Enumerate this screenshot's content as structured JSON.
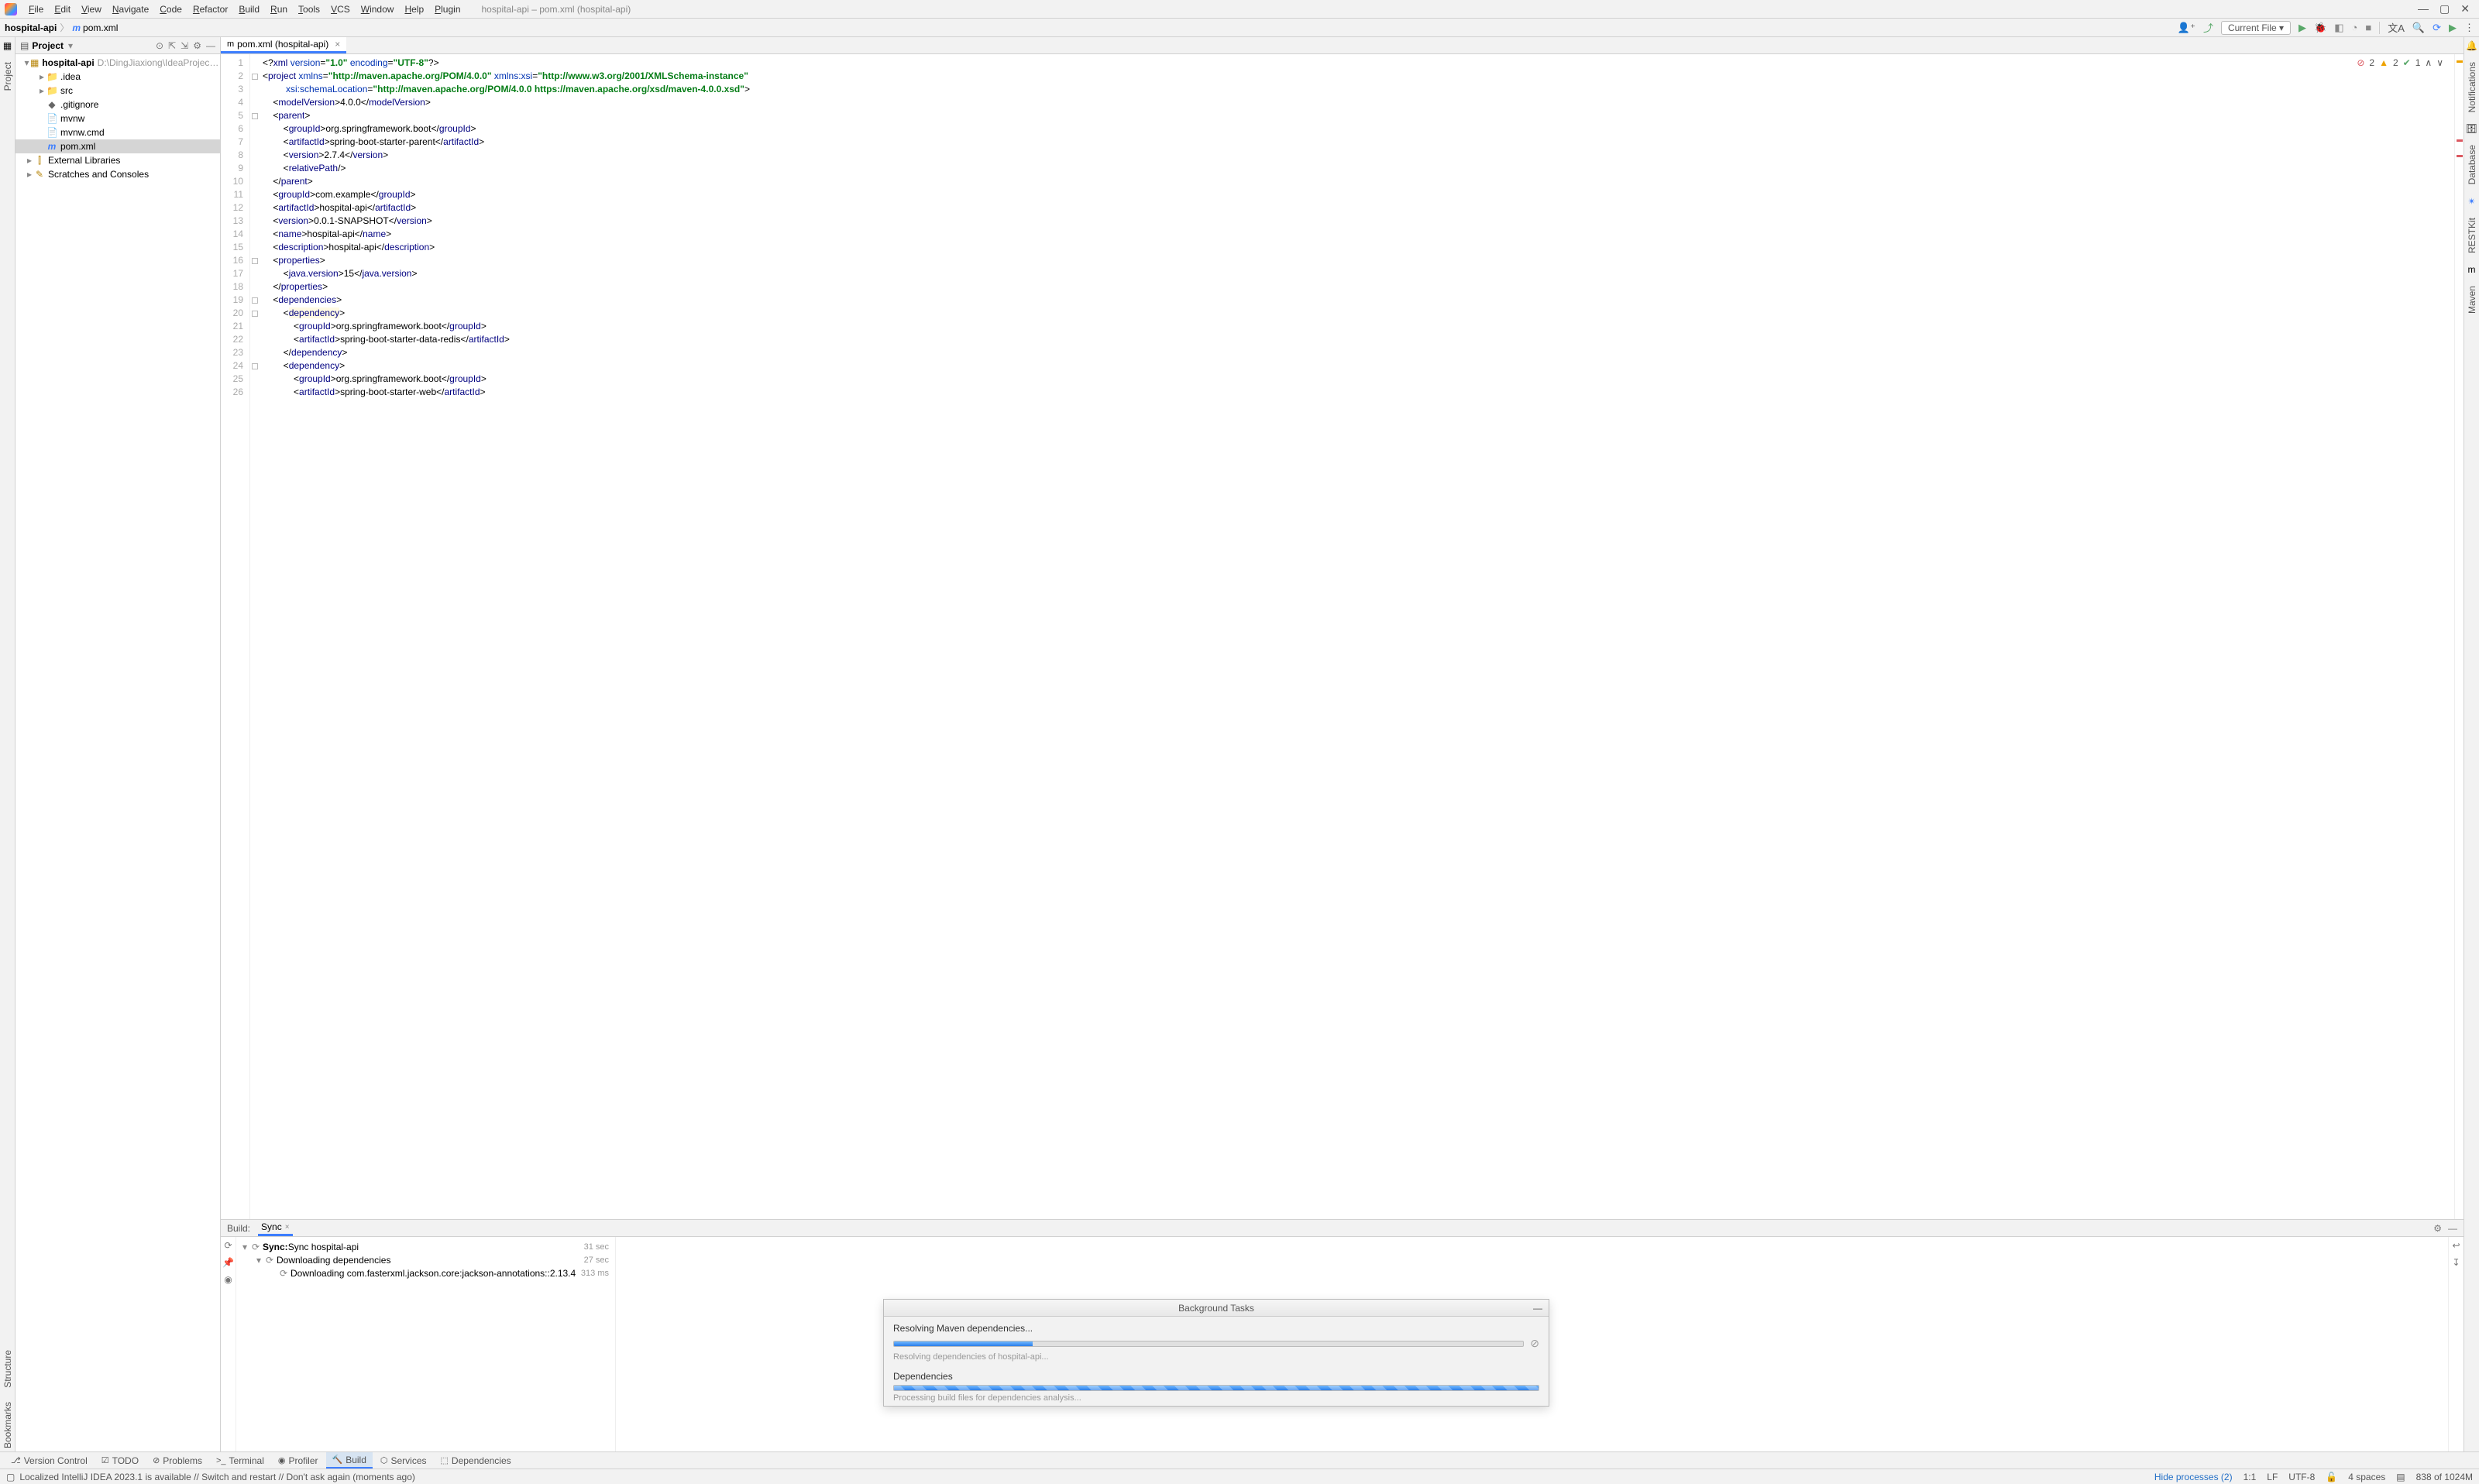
{
  "window_title": "hospital-api – pom.xml (hospital-api)",
  "menu": [
    "File",
    "Edit",
    "View",
    "Navigate",
    "Code",
    "Refactor",
    "Build",
    "Run",
    "Tools",
    "VCS",
    "Window",
    "Help",
    "Plugin"
  ],
  "navbar": {
    "crumb_project": "hospital-api",
    "crumb_file": "pom.xml",
    "run_config": "Current File"
  },
  "project_tw": {
    "title": "Project",
    "root_name": "hospital-api",
    "root_path": "D:\\DingJiaxiong\\IdeaProjects\\Shenzhou",
    "nodes": [
      {
        "depth": 0,
        "arrow": "v",
        "kind": "module",
        "label": "hospital-api",
        "muted": "D:\\DingJiaxiong\\IdeaProjects\\Shenzhou",
        "bold": true
      },
      {
        "depth": 1,
        "arrow": ">",
        "kind": "dir",
        "label": ".idea"
      },
      {
        "depth": 1,
        "arrow": ">",
        "kind": "dir",
        "label": "src"
      },
      {
        "depth": 1,
        "arrow": "",
        "kind": "file",
        "label": ".gitignore",
        "icon": "git"
      },
      {
        "depth": 1,
        "arrow": "",
        "kind": "file",
        "label": "mvnw"
      },
      {
        "depth": 1,
        "arrow": "",
        "kind": "file",
        "label": "mvnw.cmd"
      },
      {
        "depth": 1,
        "arrow": "",
        "kind": "file",
        "label": "pom.xml",
        "icon": "m",
        "selected": true
      },
      {
        "depth": 0,
        "arrow": ">",
        "kind": "lib",
        "label": "External Libraries"
      },
      {
        "depth": 0,
        "arrow": ">",
        "kind": "scratch",
        "label": "Scratches and Consoles"
      }
    ]
  },
  "editor": {
    "tab_label": "pom.xml (hospital-api)",
    "inspections": {
      "errors": "2",
      "warnings": "2",
      "ok": "1"
    },
    "lines": [
      {
        "n": 1,
        "html": "<span class='tag-br'>&lt;?</span><span class='tag-name'>xml</span> <span class='attr-name'>version</span>=<span class='attr-val'>\"1.0\"</span> <span class='attr-name'>encoding</span>=<span class='attr-val'>\"UTF-8\"</span><span class='tag-br'>?&gt;</span>"
      },
      {
        "n": 2,
        "html": "<span class='tag-br'>&lt;</span><span class='tag-name'>project</span> <span class='attr-name'>xmlns</span>=<span class='attr-val'>\"http://maven.apache.org/POM/4.0.0\"</span> <span class='attr-name'>xmlns:xsi</span>=<span class='attr-val'>\"http://www.w3.org/2001/XMLSchema-instance\"</span>"
      },
      {
        "n": 3,
        "html": "         <span class='attr-name'>xsi:schemaLocation</span>=<span class='attr-val'>\"http://maven.apache.org/POM/4.0.0 https://maven.apache.org/xsd/maven-4.0.0.xsd\"</span><span class='tag-br'>&gt;</span>"
      },
      {
        "n": 4,
        "html": "    <span class='tag-br'>&lt;</span><span class='tag-name'>modelVersion</span><span class='tag-br'>&gt;</span>4.0.0<span class='tag-br'>&lt;/</span><span class='tag-name'>modelVersion</span><span class='tag-br'>&gt;</span>"
      },
      {
        "n": 5,
        "html": "    <span class='tag-br'>&lt;</span><span class='tag-name'>parent</span><span class='tag-br'>&gt;</span>"
      },
      {
        "n": 6,
        "html": "        <span class='tag-br'>&lt;</span><span class='tag-name'>groupId</span><span class='tag-br'>&gt;</span>org.springframework.boot<span class='tag-br'>&lt;/</span><span class='tag-name'>groupId</span><span class='tag-br'>&gt;</span>"
      },
      {
        "n": 7,
        "html": "        <span class='tag-br'>&lt;</span><span class='tag-name'>artifactId</span><span class='tag-br'>&gt;</span>spring-boot-starter-parent<span class='tag-br'>&lt;/</span><span class='tag-name'>artifactId</span><span class='tag-br'>&gt;</span>"
      },
      {
        "n": 8,
        "html": "        <span class='tag-br'>&lt;</span><span class='tag-name'>version</span><span class='tag-br'>&gt;</span>2.7.4<span class='tag-br'>&lt;/</span><span class='tag-name'>version</span><span class='tag-br'>&gt;</span>"
      },
      {
        "n": 9,
        "html": "        <span class='tag-br'>&lt;</span><span class='tag-name'>relativePath</span><span class='tag-br'>/&gt;</span>"
      },
      {
        "n": 10,
        "html": "    <span class='tag-br'>&lt;/</span><span class='tag-name'>parent</span><span class='tag-br'>&gt;</span>"
      },
      {
        "n": 11,
        "html": "    <span class='tag-br'>&lt;</span><span class='tag-name'>groupId</span><span class='tag-br'>&gt;</span>com.example<span class='tag-br'>&lt;/</span><span class='tag-name'>groupId</span><span class='tag-br'>&gt;</span>"
      },
      {
        "n": 12,
        "html": "    <span class='tag-br'>&lt;</span><span class='tag-name'>artifactId</span><span class='tag-br'>&gt;</span>hospital-api<span class='tag-br'>&lt;/</span><span class='tag-name'>artifactId</span><span class='tag-br'>&gt;</span>"
      },
      {
        "n": 13,
        "html": "    <span class='tag-br'>&lt;</span><span class='tag-name'>version</span><span class='tag-br'>&gt;</span>0.0.1-SNAPSHOT<span class='tag-br'>&lt;/</span><span class='tag-name'>version</span><span class='tag-br'>&gt;</span>"
      },
      {
        "n": 14,
        "html": "    <span class='tag-br'>&lt;</span><span class='tag-name'>name</span><span class='tag-br'>&gt;</span>hospital-api<span class='tag-br'>&lt;/</span><span class='tag-name'>name</span><span class='tag-br'>&gt;</span>"
      },
      {
        "n": 15,
        "html": "    <span class='tag-br'>&lt;</span><span class='tag-name'>description</span><span class='tag-br'>&gt;</span>hospital-api<span class='tag-br'>&lt;/</span><span class='tag-name'>description</span><span class='tag-br'>&gt;</span>"
      },
      {
        "n": 16,
        "html": "    <span class='tag-br'>&lt;</span><span class='tag-name'>properties</span><span class='tag-br'>&gt;</span>"
      },
      {
        "n": 17,
        "html": "        <span class='tag-br'>&lt;</span><span class='tag-name'>java.version</span><span class='tag-br'>&gt;</span>15<span class='tag-br'>&lt;/</span><span class='tag-name'>java.version</span><span class='tag-br'>&gt;</span>"
      },
      {
        "n": 18,
        "html": "    <span class='tag-br'>&lt;/</span><span class='tag-name'>properties</span><span class='tag-br'>&gt;</span>"
      },
      {
        "n": 19,
        "html": "    <span class='tag-br'>&lt;</span><span class='tag-name'>dependencies</span><span class='tag-br'>&gt;</span>"
      },
      {
        "n": 20,
        "html": "        <span class='tag-br'>&lt;</span><span class='tag-name hl'>dependency</span><span class='tag-br'>&gt;</span>"
      },
      {
        "n": 21,
        "html": "            <span class='tag-br'>&lt;</span><span class='tag-name'>groupId</span><span class='tag-br'>&gt;</span>org.springframework.boot<span class='tag-br'>&lt;/</span><span class='tag-name'>groupId</span><span class='tag-br'>&gt;</span>"
      },
      {
        "n": 22,
        "html": "            <span class='tag-br'>&lt;</span><span class='tag-name'>artifactId</span><span class='tag-br'>&gt;</span>spring-boot-starter-data-redis<span class='tag-br'>&lt;/</span><span class='tag-name'>artifactId</span><span class='tag-br'>&gt;</span>"
      },
      {
        "n": 23,
        "html": "        <span class='tag-br'>&lt;/</span><span class='tag-name'>dependency</span><span class='tag-br'>&gt;</span>"
      },
      {
        "n": 24,
        "html": "        <span class='tag-br'>&lt;</span><span class='tag-name'>dependency</span><span class='tag-br'>&gt;</span>"
      },
      {
        "n": 25,
        "html": "            <span class='tag-br'>&lt;</span><span class='tag-name'>groupId</span><span class='tag-br'>&gt;</span>org.springframework.boot<span class='tag-br'>&lt;/</span><span class='tag-name'>groupId</span><span class='tag-br'>&gt;</span>"
      },
      {
        "n": 26,
        "html": "            <span class='tag-br'>&lt;</span><span class='tag-name'>artifactId</span><span class='tag-br'>&gt;</span>spring-boot-starter-web<span class='tag-br'>&lt;/</span><span class='tag-name'>artifactId</span><span class='tag-br'>&gt;</span>"
      }
    ]
  },
  "build": {
    "title": "Build:",
    "tab": "Sync",
    "rows": [
      {
        "depth": 0,
        "arrow": "v",
        "label_strong": "Sync:",
        "label": " Sync hospital-api",
        "time": "31 sec"
      },
      {
        "depth": 1,
        "arrow": "v",
        "label": "Downloading dependencies",
        "time": "27 sec"
      },
      {
        "depth": 2,
        "arrow": "",
        "label": "Downloading com.fasterxml.jackson.core:jackson-annotations::2.13.4",
        "time": "313 ms"
      }
    ]
  },
  "bg_tasks": {
    "title": "Background Tasks",
    "tasks": [
      {
        "title": "Resolving Maven dependencies...",
        "detail": "Resolving dependencies of hospital-api...",
        "progress": 22,
        "cancellable": true,
        "indeterminate": false
      },
      {
        "title": "Dependencies",
        "detail": "Processing build files for dependencies analysis...",
        "progress": 100,
        "cancellable": false,
        "indeterminate": true
      }
    ]
  },
  "bottom_tabs": [
    {
      "icon": "⎇",
      "label": "Version Control"
    },
    {
      "icon": "☑",
      "label": "TODO"
    },
    {
      "icon": "⊘",
      "label": "Problems"
    },
    {
      "icon": ">_",
      "label": "Terminal"
    },
    {
      "icon": "◉",
      "label": "Profiler"
    },
    {
      "icon": "🔨",
      "label": "Build",
      "active": true
    },
    {
      "icon": "⬡",
      "label": "Services"
    },
    {
      "icon": "⬚",
      "label": "Dependencies"
    }
  ],
  "statusbar": {
    "message": "Localized IntelliJ IDEA 2023.1 is available // Switch and restart // Don't ask again (moments ago)",
    "hide_processes": "Hide processes (2)",
    "pos": "1:1",
    "eol": "LF",
    "encoding": "UTF-8",
    "indent": "4 spaces",
    "memory": "838 of 1024M"
  },
  "right_labels": [
    "Notifications",
    "Database",
    "RESTKit",
    "Maven"
  ],
  "left_labels": [
    "Project",
    "Structure",
    "Bookmarks"
  ]
}
